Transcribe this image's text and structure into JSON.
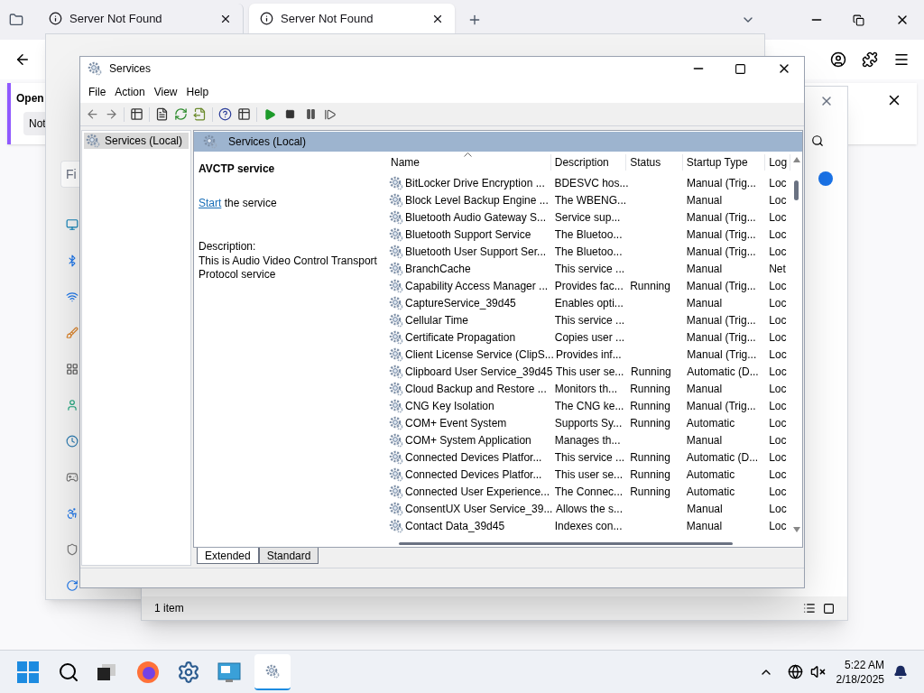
{
  "browser": {
    "tabs": [
      {
        "title": "Server Not Found",
        "selected": false
      },
      {
        "title": "Server Not Found",
        "selected": true
      }
    ],
    "notification": {
      "title": "Open",
      "button": "Not"
    }
  },
  "settings_window": {
    "search_placeholder": "Fi"
  },
  "explorer_window": {
    "status": "1 item"
  },
  "services_window": {
    "title": "Services",
    "menu": [
      "File",
      "Action",
      "View",
      "Help"
    ],
    "tree": [
      {
        "label": "Services (Local)",
        "selected": true
      }
    ],
    "pane_title": "Services (Local)",
    "details": {
      "service_name": "AVCTP service",
      "action_link": "Start",
      "action_text": "the service",
      "description_label": "Description:",
      "description": "This is Audio Video Control Transport Protocol service"
    },
    "table": {
      "columns": [
        "Name",
        "Description",
        "Status",
        "Startup Type",
        "Log"
      ],
      "rows": [
        {
          "name": "BitLocker Drive Encryption ...",
          "description": "BDESVC hos...",
          "status": "",
          "startup": "Manual (Trig...",
          "log": "Loc"
        },
        {
          "name": "Block Level Backup Engine ...",
          "description": "The WBENG...",
          "status": "",
          "startup": "Manual",
          "log": "Loc"
        },
        {
          "name": "Bluetooth Audio Gateway S...",
          "description": "Service sup...",
          "status": "",
          "startup": "Manual (Trig...",
          "log": "Loc"
        },
        {
          "name": "Bluetooth Support Service",
          "description": "The Bluetoo...",
          "status": "",
          "startup": "Manual (Trig...",
          "log": "Loc"
        },
        {
          "name": "Bluetooth User Support Ser...",
          "description": "The Bluetoo...",
          "status": "",
          "startup": "Manual (Trig...",
          "log": "Loc"
        },
        {
          "name": "BranchCache",
          "description": "This service ...",
          "status": "",
          "startup": "Manual",
          "log": "Net"
        },
        {
          "name": "Capability Access Manager ...",
          "description": "Provides fac...",
          "status": "Running",
          "startup": "Manual (Trig...",
          "log": "Loc"
        },
        {
          "name": "CaptureService_39d45",
          "description": "Enables opti...",
          "status": "",
          "startup": "Manual",
          "log": "Loc"
        },
        {
          "name": "Cellular Time",
          "description": "This service ...",
          "status": "",
          "startup": "Manual (Trig...",
          "log": "Loc"
        },
        {
          "name": "Certificate Propagation",
          "description": "Copies user ...",
          "status": "",
          "startup": "Manual (Trig...",
          "log": "Loc"
        },
        {
          "name": "Client License Service (ClipS...",
          "description": "Provides inf...",
          "status": "",
          "startup": "Manual (Trig...",
          "log": "Loc"
        },
        {
          "name": "Clipboard User Service_39d45",
          "description": "This user se...",
          "status": "Running",
          "startup": "Automatic (D...",
          "log": "Loc"
        },
        {
          "name": "Cloud Backup and Restore ...",
          "description": "Monitors th...",
          "status": "Running",
          "startup": "Manual",
          "log": "Loc"
        },
        {
          "name": "CNG Key Isolation",
          "description": "The CNG ke...",
          "status": "Running",
          "startup": "Manual (Trig...",
          "log": "Loc"
        },
        {
          "name": "COM+ Event System",
          "description": "Supports Sy...",
          "status": "Running",
          "startup": "Automatic",
          "log": "Loc"
        },
        {
          "name": "COM+ System Application",
          "description": "Manages th...",
          "status": "",
          "startup": "Manual",
          "log": "Loc"
        },
        {
          "name": "Connected Devices Platfor...",
          "description": "This service ...",
          "status": "Running",
          "startup": "Automatic (D...",
          "log": "Loc"
        },
        {
          "name": "Connected Devices Platfor...",
          "description": "This user se...",
          "status": "Running",
          "startup": "Automatic",
          "log": "Loc"
        },
        {
          "name": "Connected User Experience...",
          "description": "The Connec...",
          "status": "Running",
          "startup": "Automatic",
          "log": "Loc"
        },
        {
          "name": "ConsentUX User Service_39...",
          "description": "Allows the s...",
          "status": "",
          "startup": "Manual",
          "log": "Loc"
        },
        {
          "name": "Contact Data_39d45",
          "description": "Indexes con...",
          "status": "",
          "startup": "Manual",
          "log": "Loc"
        }
      ]
    },
    "view_tabs": [
      {
        "label": "Extended",
        "selected": true
      },
      {
        "label": "Standard",
        "selected": false
      }
    ]
  },
  "taskbar": {
    "time": "5:22 AM",
    "date": "2/18/2025"
  }
}
